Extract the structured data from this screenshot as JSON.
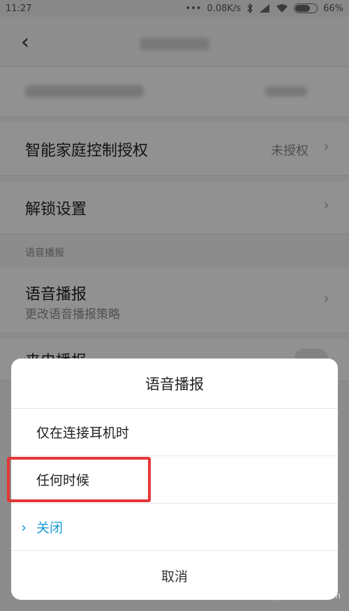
{
  "status_bar": {
    "time": "11:27",
    "dots": "•••",
    "network_speed": "0.08K/s",
    "battery": "66%",
    "battery_level": 0.66
  },
  "header": {
    "back_icon": "‹"
  },
  "rows": {
    "smart_home_label": "智能家庭控制授权",
    "smart_home_value": "未授权",
    "unlock_label": "解锁设置",
    "section_voice": "语音播报",
    "voice_label": "语音播报",
    "voice_sub": "更改语音播报策略",
    "partial_label": "来电播报",
    "chevron": "›"
  },
  "sheet": {
    "title": "语音播报",
    "options": [
      {
        "label": "仅在连接耳机时"
      },
      {
        "label": "任何时候"
      },
      {
        "label": "关闭",
        "selected": true
      }
    ],
    "selected_icon": "›",
    "cancel": "取消"
  },
  "watermark": "Bai 经验 jingyan.baidu.com",
  "colors": {
    "accent": "#1a9bd4",
    "highlight": "#e53636"
  },
  "icons": [
    "bluetooth-icon",
    "signal-icon",
    "wifi-icon",
    "battery-icon"
  ]
}
